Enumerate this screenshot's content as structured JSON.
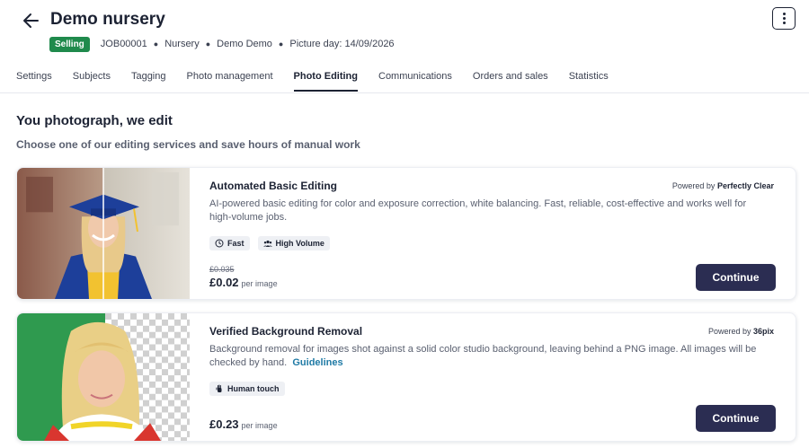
{
  "header": {
    "title": "Demo nursery",
    "badge": "Selling",
    "job_id": "JOB00001",
    "type": "Nursery",
    "owner": "Demo Demo",
    "picture_day": "Picture day: 14/09/2026"
  },
  "tabs": [
    "Settings",
    "Subjects",
    "Tagging",
    "Photo management",
    "Photo Editing",
    "Communications",
    "Orders and sales",
    "Statistics"
  ],
  "active_tab": "Photo Editing",
  "section": {
    "title": "You photograph, we edit",
    "subtitle": "Choose one of our editing services and save hours of manual work"
  },
  "services": [
    {
      "title": "Automated Basic Editing",
      "powered_prefix": "Powered by",
      "powered_by": "Perfectly Clear",
      "description": "AI-powered basic editing for color and exposure correction, white balancing. Fast, reliable, cost-effective and works well for high-volume jobs.",
      "chips": [
        "Fast",
        "High Volume"
      ],
      "old_price": "£0.035",
      "price": "£0.02",
      "unit": "per image",
      "button": "Continue"
    },
    {
      "title": "Verified Background Removal",
      "powered_prefix": "Powered by",
      "powered_by": "36pix",
      "description": "Background removal for images shot against a solid color studio background, leaving behind a PNG image. All images will be checked by hand.",
      "link": "Guidelines",
      "chips": [
        "Human touch"
      ],
      "price": "£0.23",
      "unit": "per image",
      "button": "Continue"
    }
  ],
  "colors": {
    "badge": "#1f8a4c",
    "button": "#2b2d52",
    "link": "#1f7aa5",
    "green_screen": "#2f9a4f"
  }
}
